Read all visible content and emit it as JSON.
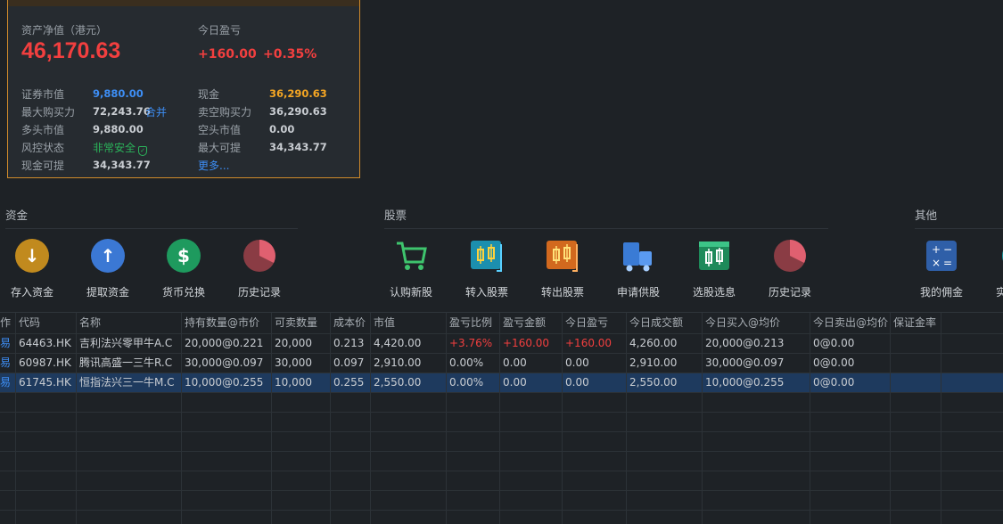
{
  "account": {
    "net_asset_label": "资产净值（港元）",
    "net_asset_value": "46,170.63",
    "today_pl_label": "今日盈亏",
    "today_pl_value": "+160.00",
    "today_pl_pct": "+0.35%",
    "securities_value_label": "证券市值",
    "securities_value": "9,880.00",
    "cash_label": "现金",
    "cash_value": "36,290.63",
    "max_buy_label": "最大购买力",
    "max_buy_value": "72,243.76",
    "max_buy_link": "合并",
    "short_buy_label": "卖空购买力",
    "short_buy_value": "36,290.63",
    "long_value_label": "多头市值",
    "long_value": "9,880.00",
    "short_value_label": "空头市值",
    "short_value": "0.00",
    "risk_label": "风控状态",
    "risk_value": "非常安全",
    "max_withdraw_label": "最大可提",
    "max_withdraw_value": "34,343.77",
    "cash_withdraw_label": "现金可提",
    "cash_withdraw_value": "34,343.77",
    "more_link": "更多..."
  },
  "sections": {
    "funds": {
      "title": "资金",
      "tiles": [
        "存入资金",
        "提取资金",
        "货币兑换",
        "历史记录"
      ]
    },
    "stocks": {
      "title": "股票",
      "tiles": [
        "认购新股",
        "转入股票",
        "转出股票",
        "申请供股",
        "选股选息",
        "历史记录"
      ]
    },
    "other": {
      "title": "其他",
      "tiles": [
        "我的佣金",
        "实"
      ]
    }
  },
  "table": {
    "headers": [
      "作",
      "代码",
      "名称",
      "持有数量@市价",
      "可卖数量",
      "成本价",
      "市值",
      "盈亏比例",
      "盈亏金额",
      "今日盈亏",
      "今日成交额",
      "今日买入@均价",
      "今日卖出@均价",
      "保证金率"
    ],
    "rows": [
      [
        "易",
        "64463.HK",
        "吉利法兴零甲牛A.C",
        "20,000@0.221",
        "20,000",
        "0.213",
        "4,420.00",
        "+3.76%",
        "+160.00",
        "+160.00",
        "4,260.00",
        "20,000@0.213",
        "0@0.00",
        ""
      ],
      [
        "易",
        "60987.HK",
        "腾讯高盛一三牛R.C",
        "30,000@0.097",
        "30,000",
        "0.097",
        "2,910.00",
        "0.00%",
        "0.00",
        "0.00",
        "2,910.00",
        "30,000@0.097",
        "0@0.00",
        ""
      ],
      [
        "易",
        "61745.HK",
        "恒指法兴三一牛M.C",
        "10,000@0.255",
        "10,000",
        "0.255",
        "2,550.00",
        "0.00%",
        "0.00",
        "0.00",
        "2,550.00",
        "10,000@0.255",
        "0@0.00",
        ""
      ]
    ],
    "selected_row": 2
  },
  "colors": {
    "accent_orange": "#d08a2a",
    "profit_red": "#f23f3f",
    "link_blue": "#3d8ef5",
    "safe_green": "#2bb35a",
    "selected_row": "#1e3a5e"
  }
}
